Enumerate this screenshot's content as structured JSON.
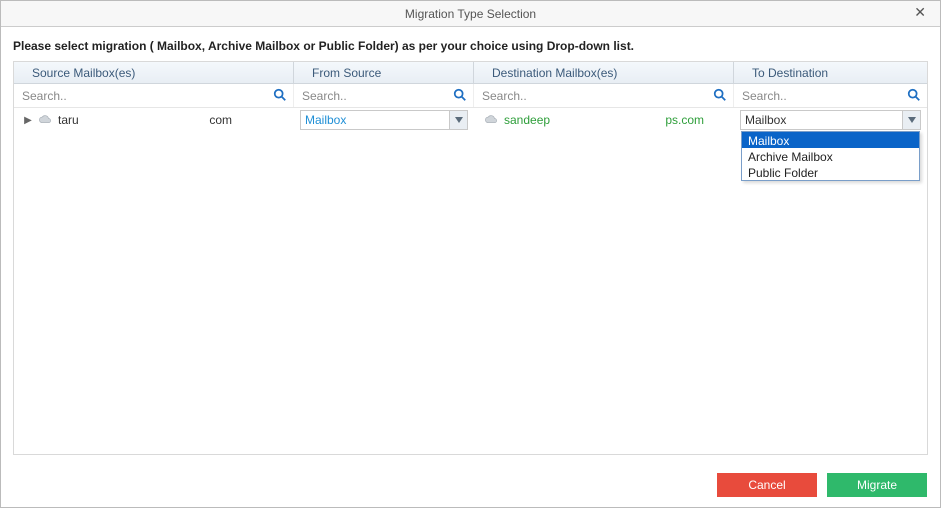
{
  "window": {
    "title": "Migration Type Selection",
    "close_glyph": "✕"
  },
  "instruction": "Please select migration ( Mailbox, Archive Mailbox or Public Folder) as per your choice using Drop-down list.",
  "columns": {
    "source_mailboxes": "Source Mailbox(es)",
    "from_source": "From Source",
    "destination_mailboxes": "Destination Mailbox(es)",
    "to_destination": "To Destination"
  },
  "search": {
    "placeholder": "Search.."
  },
  "row": {
    "source_name": "taru",
    "source_domain": "com",
    "from_source_value": "Mailbox",
    "dest_name": "sandeep",
    "dest_domain": "ps.com",
    "to_destination_value": "Mailbox"
  },
  "dropdown": {
    "items": [
      "Mailbox",
      "Archive Mailbox",
      "Public Folder"
    ],
    "selected_index": 0
  },
  "buttons": {
    "cancel": "Cancel",
    "migrate": "Migrate"
  },
  "icons": {
    "expander": "▶"
  }
}
